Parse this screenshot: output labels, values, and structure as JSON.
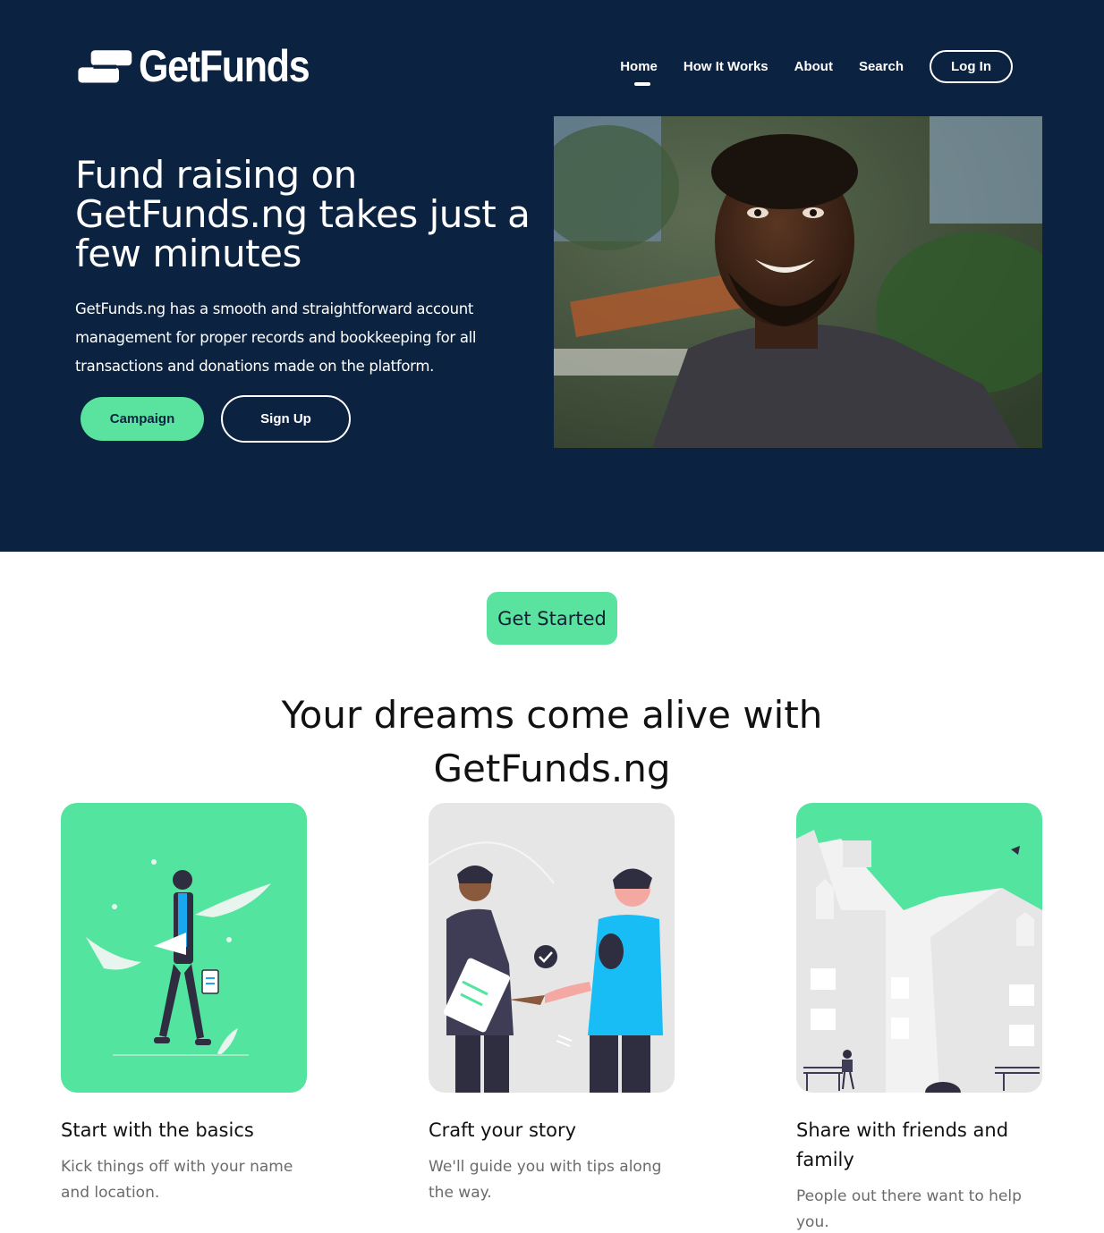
{
  "brand": {
    "name": "GetFunds",
    "accent": "#59e39e",
    "navy": "#0b2341"
  },
  "nav": {
    "items": [
      "Home",
      "How It Works",
      "About",
      "Search"
    ],
    "active": "Home",
    "login_label": "Log In"
  },
  "hero": {
    "title": "Fund raising on GetFunds.ng takes just a few minutes",
    "description": "GetFunds.ng has a smooth and straightforward account management for proper records and bookkeeping for all transactions and donations made on the platform.",
    "campaign_label": "Campaign",
    "signup_label": "Sign Up"
  },
  "main": {
    "get_started_label": "Get Started",
    "title_line1": "Your dreams come alive with",
    "title_line2": "GetFunds.ng",
    "cards": [
      {
        "title": "Start with the basics",
        "text": "Kick things off with your name and location."
      },
      {
        "title": "Craft your story",
        "text": "We'll guide you with tips along the way."
      },
      {
        "title": "Share with friends and family",
        "text": "People out there want to help you."
      }
    ]
  }
}
